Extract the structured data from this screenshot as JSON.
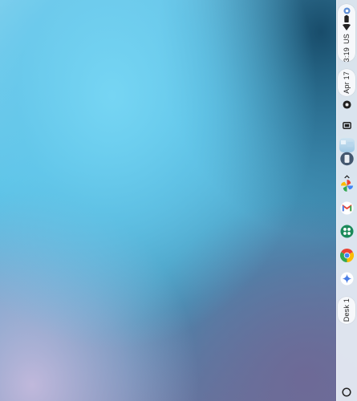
{
  "status": {
    "time": "3:19",
    "locale": "US"
  },
  "calendar": {
    "date": "Apr 17"
  },
  "desks": {
    "current": "Desk 1"
  },
  "shelf_apps": [
    {
      "icon": "files-icon"
    },
    {
      "icon": "photos-icon"
    },
    {
      "icon": "gmail-icon"
    },
    {
      "icon": "play-store-icon"
    },
    {
      "icon": "chrome-icon"
    },
    {
      "icon": "assistant-icon"
    }
  ],
  "colors": {
    "shelf_background": "#e8eef5",
    "pill_background": "#f6f8fb",
    "accent": "#1a73e8"
  }
}
